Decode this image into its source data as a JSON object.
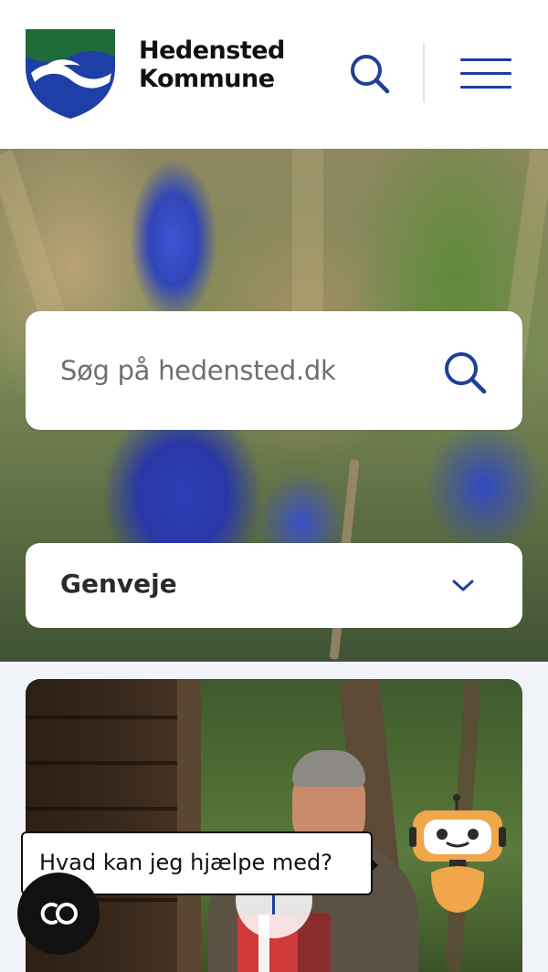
{
  "header": {
    "logo_line1": "Hedensted",
    "logo_line2": "Kommune",
    "search_icon": "search-icon",
    "menu_icon": "hamburger-menu-icon"
  },
  "hero": {
    "search_placeholder": "Søg på hedensted.dk",
    "search_icon": "search-icon",
    "shortcuts_label": "Genveje",
    "shortcuts_icon": "chevron-down-icon"
  },
  "chat": {
    "prompt_text": "Hvad kan jeg hjælpe med?",
    "launcher_icon": "co-logo-icon",
    "bot_icon": "robot-assistant-icon"
  },
  "colors": {
    "brand_blue": "#1e3f99",
    "brand_green": "#1f6b3a",
    "text_dark": "#111111"
  }
}
